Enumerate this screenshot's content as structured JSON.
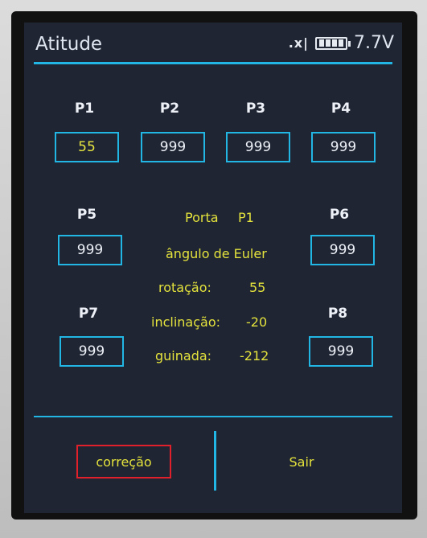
{
  "header": {
    "title": "Atitude",
    "signal": ".x|",
    "voltage": "7.7V"
  },
  "ports": {
    "p1": {
      "label": "P1",
      "value": "55"
    },
    "p2": {
      "label": "P2",
      "value": "999"
    },
    "p3": {
      "label": "P3",
      "value": "999"
    },
    "p4": {
      "label": "P4",
      "value": "999"
    },
    "p5": {
      "label": "P5",
      "value": "999"
    },
    "p6": {
      "label": "P6",
      "value": "999"
    },
    "p7": {
      "label": "P7",
      "value": "999"
    },
    "p8": {
      "label": "P8",
      "value": "999"
    }
  },
  "info": {
    "port_prefix": "Porta",
    "port_name": "P1",
    "subtitle": "ângulo de Euler",
    "roll_label": "rotação:",
    "roll_value": "55",
    "pitch_label": "inclinação:",
    "pitch_value": "-20",
    "yaw_label": "guinada:",
    "yaw_value": "-212"
  },
  "footer": {
    "correction_label": "correção",
    "exit_label": "Sair"
  },
  "colors": {
    "accent": "#22b6e4",
    "value_text": "#e4e23c",
    "highlight_border": "#e0202a",
    "screen_bg": "#1f2533"
  },
  "battery_level": 0.85
}
